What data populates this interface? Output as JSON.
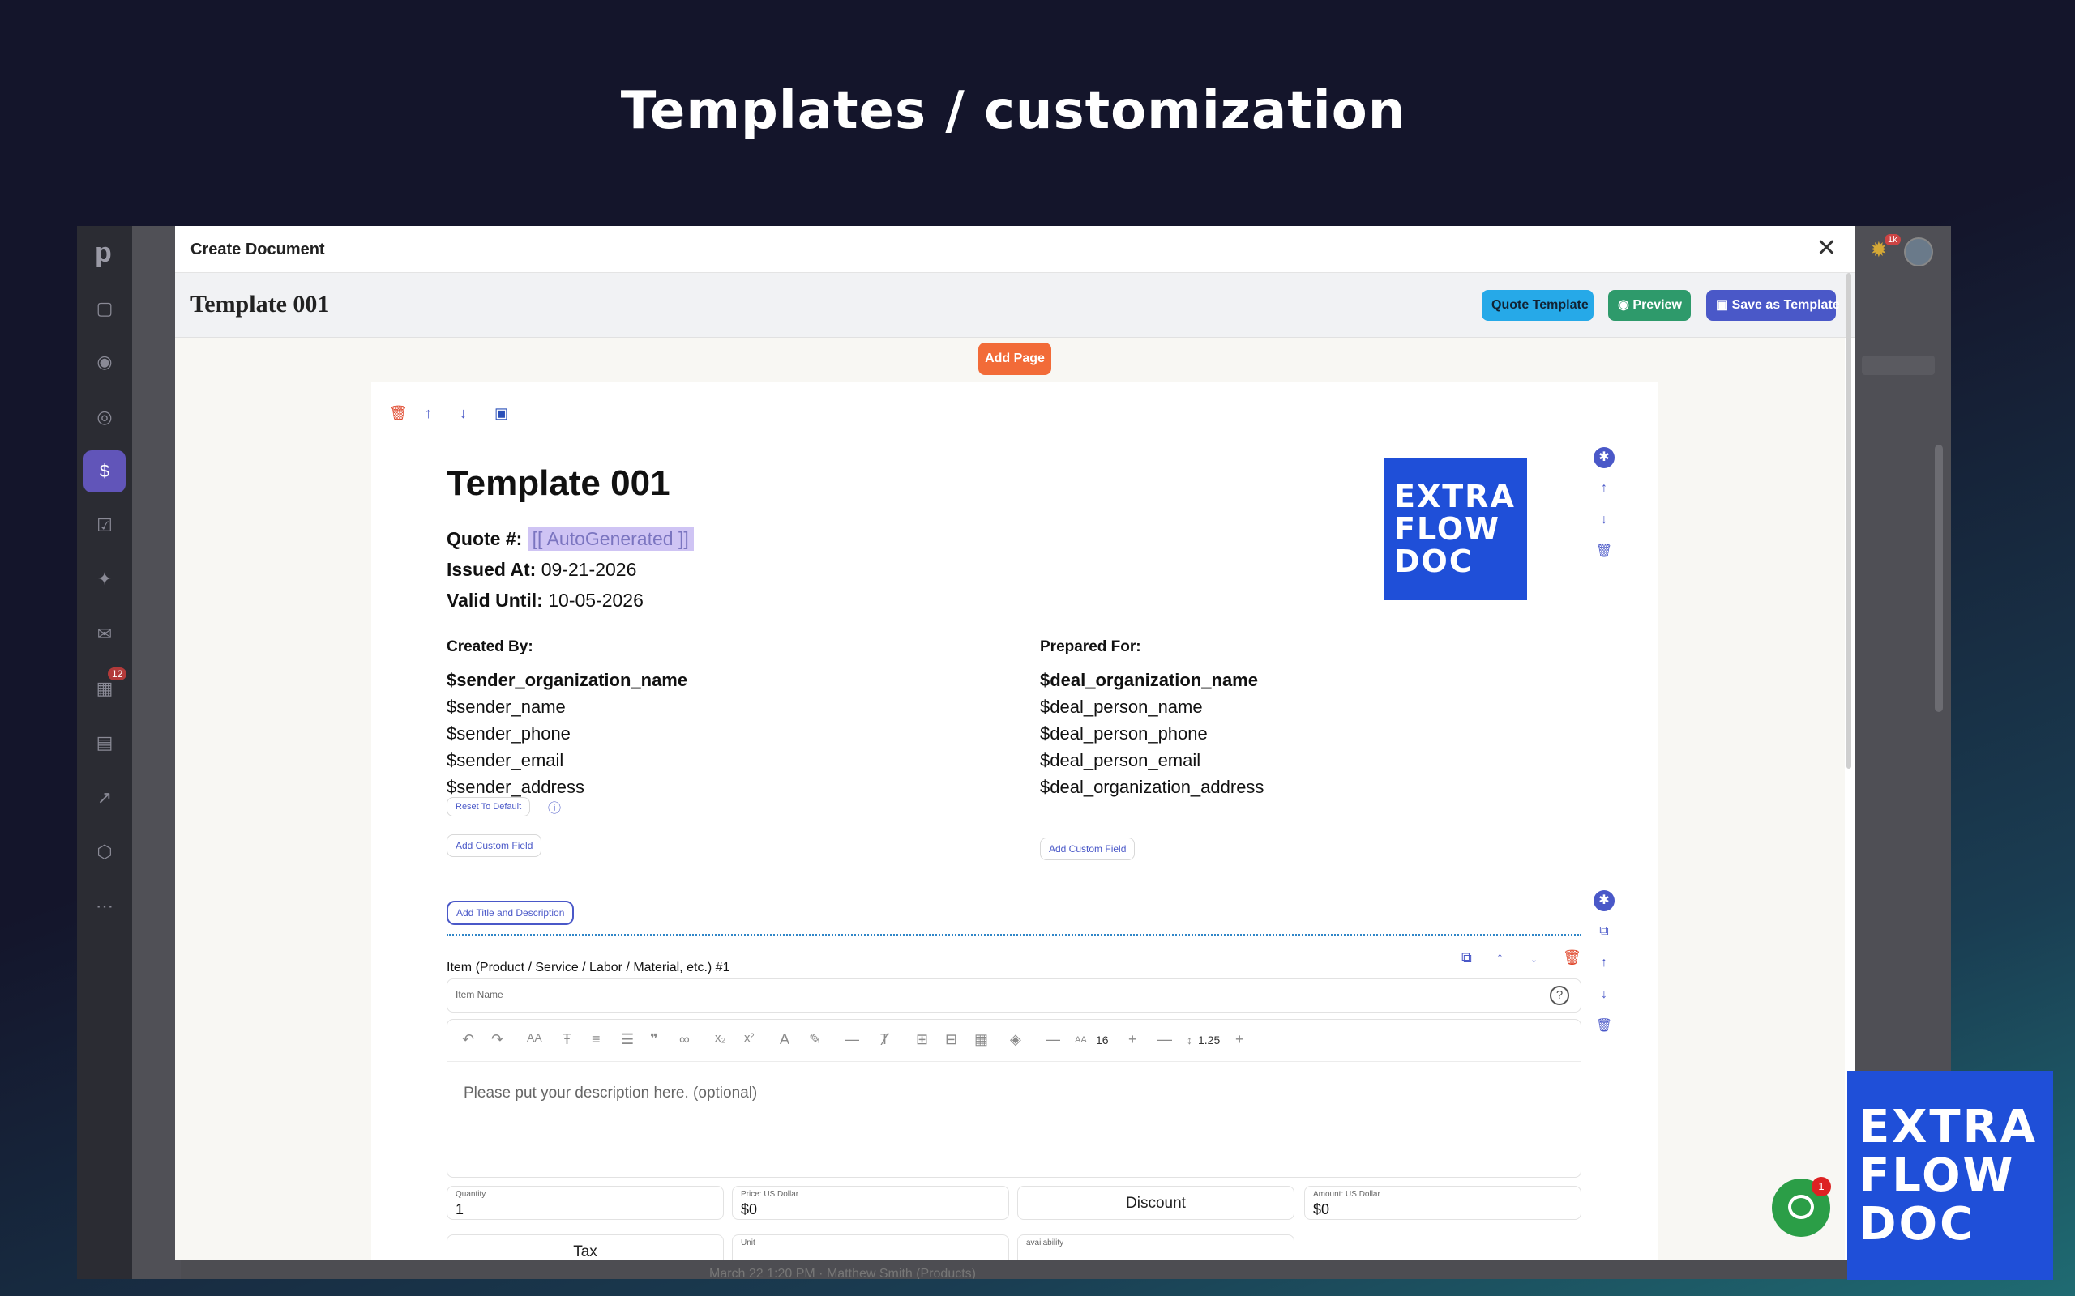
{
  "hero": {
    "title": "Templates / customization"
  },
  "background_app": {
    "sidebar_logo": "p",
    "badge_count": "12",
    "notification_count": "1k",
    "footer_text": "March 22 1:20 PM · Matthew Smith (Products)"
  },
  "modal": {
    "title": "Create Document",
    "close": "✕",
    "template_name": "Template 001",
    "buttons": {
      "quote_template": "Quote Template",
      "preview": "Preview",
      "save_as_template": "Save as Template",
      "add_page": "Add Page"
    }
  },
  "document": {
    "title": "Template 001",
    "quote_label": "Quote #:",
    "quote_value": "[[ AutoGenerated ]]",
    "issued_label": "Issued At:",
    "issued_value": "09-21-2026",
    "valid_label": "Valid Until:",
    "valid_value": "10-05-2026",
    "logo_lines": [
      "EXTRA",
      "FLOW",
      "DOC"
    ],
    "created_by": {
      "label": "Created By:",
      "lines": [
        "$sender_organization_name",
        "$sender_name",
        "$sender_phone",
        "$sender_email",
        "$sender_address"
      ],
      "reset": "Reset To Default",
      "add_custom": "Add Custom Field"
    },
    "prepared_for": {
      "label": "Prepared For:",
      "lines": [
        "$deal_organization_name",
        "$deal_person_name",
        "$deal_person_phone",
        "$deal_person_email",
        "$deal_organization_address"
      ],
      "add_custom": "Add Custom Field"
    },
    "add_title_description": "Add Title and Description",
    "item": {
      "label": "Item (Product / Service / Labor / Material, etc.) #1",
      "name_placeholder": "Item Name",
      "description_placeholder": "Please put your description here. (optional)",
      "font_size": "16",
      "line_height": "1.25",
      "quantity_caption": "Quantity",
      "quantity_value": "1",
      "price_caption": "Price: US Dollar",
      "price_value": "$0",
      "discount_label": "Discount",
      "amount_caption": "Amount: US Dollar",
      "amount_value": "$0",
      "tax_label": "Tax",
      "unit_caption": "Unit",
      "availability_caption": "availability"
    }
  },
  "chat": {
    "count": "1"
  },
  "brand": {
    "lines": [
      "EXTRA",
      "FLOW",
      "DOC"
    ]
  },
  "colors": {
    "accent": "#4a58c8",
    "quote_btn": "#26a9e8",
    "preview_btn": "#2e9a6b",
    "add_page_btn": "#f26b38",
    "logo_blue": "#1f4fd8"
  }
}
